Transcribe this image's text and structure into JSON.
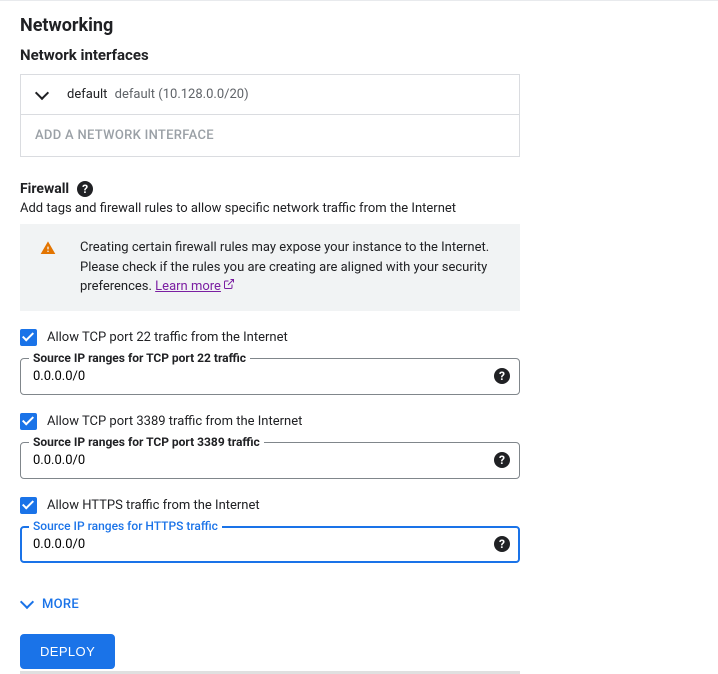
{
  "heading": "Networking",
  "subheading": "Network interfaces",
  "interface": {
    "name": "default",
    "detail": "default (10.128.0.0/20)"
  },
  "addInterface": "ADD A NETWORK INTERFACE",
  "firewall": {
    "title": "Firewall",
    "help": "?",
    "subtext": "Add tags and firewall rules to allow specific network traffic from the Internet",
    "banner": "Creating certain firewall rules may expose your instance to the Internet. Please check if the rules you are creating are aligned with your security preferences.",
    "learnMore": "Learn more"
  },
  "rules": [
    {
      "checkLabel": "Allow TCP port 22 traffic from the Internet",
      "fieldLabel": "Source IP ranges for TCP port 22 traffic",
      "value": "0.0.0.0/0",
      "focused": false
    },
    {
      "checkLabel": "Allow TCP port 3389 traffic from the Internet",
      "fieldLabel": "Source IP ranges for TCP port 3389 traffic",
      "value": "0.0.0.0/0",
      "focused": false
    },
    {
      "checkLabel": "Allow HTTPS traffic from the Internet",
      "fieldLabel": "Source IP ranges for HTTPS traffic",
      "value": "0.0.0.0/0",
      "focused": true
    }
  ],
  "more": "MORE",
  "deploy": "DEPLOY"
}
